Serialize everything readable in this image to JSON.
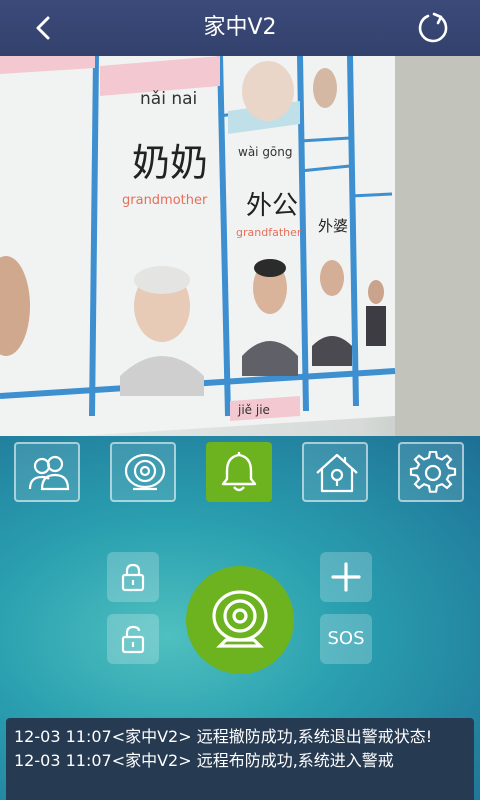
{
  "header": {
    "title": "家中V2",
    "back_icon": "chevron-left-icon",
    "refresh_icon": "refresh-icon"
  },
  "camera": {
    "poster_texts": [
      "nǎi nai",
      "奶奶",
      "grandmother",
      "wài gōng",
      "外公",
      "grandfather",
      "外婆",
      "jiě jie"
    ]
  },
  "tabs": [
    {
      "name": "contacts",
      "icon": "users-icon",
      "active": false
    },
    {
      "name": "camera",
      "icon": "webcam-icon",
      "active": false
    },
    {
      "name": "alarm",
      "icon": "bell-icon",
      "active": true
    },
    {
      "name": "home",
      "icon": "home-icon",
      "active": false
    },
    {
      "name": "settings",
      "icon": "gear-icon",
      "active": false
    }
  ],
  "controls": {
    "lock_icon": "lock-closed-icon",
    "unlock_icon": "lock-open-icon",
    "add_icon": "plus-icon",
    "sos_label": "SOS",
    "center_icon": "webcam-icon"
  },
  "log": {
    "lines": [
      "12-03 11:07<家中V2> 远程撤防成功,系统退出警戒状态!",
      "12-03 11:07<家中V2> 远程布防成功,系统进入警戒"
    ]
  },
  "colors": {
    "header": "#36446f",
    "active_green": "#6cb31f",
    "log_bg": "#263a52"
  }
}
